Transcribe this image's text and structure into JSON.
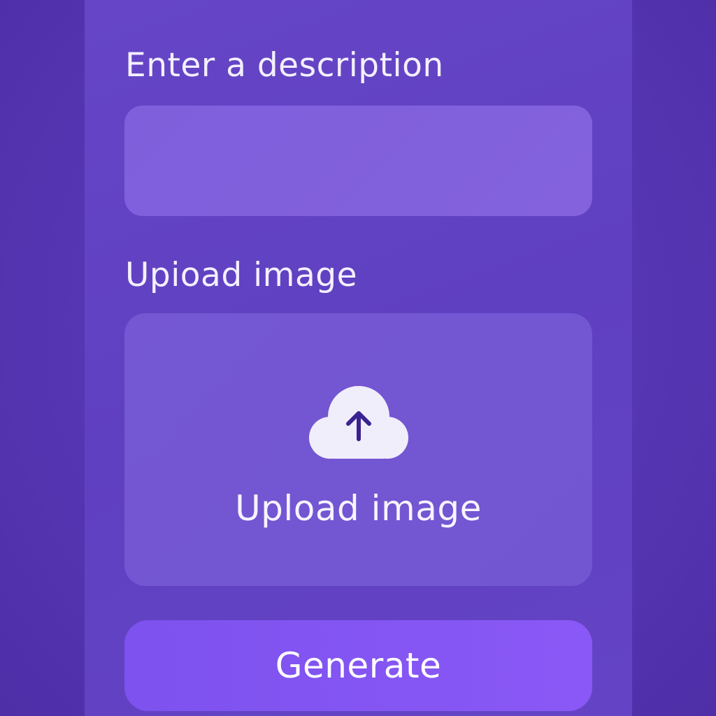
{
  "form": {
    "description_label": "Enter a description",
    "description_value": "",
    "upload_label": "Upioad image",
    "upload_zone_text": "Upload image",
    "generate_label": "Generate"
  },
  "icons": {
    "upload": "cloud-upload-icon"
  },
  "colors": {
    "background": "#5534b0",
    "panel": "#6243c3",
    "input": "#8262dd",
    "upload_zone": "#7356d2",
    "button": "#8657f3",
    "icon_fill": "#f1eefc",
    "icon_arrow": "#3a2390"
  }
}
